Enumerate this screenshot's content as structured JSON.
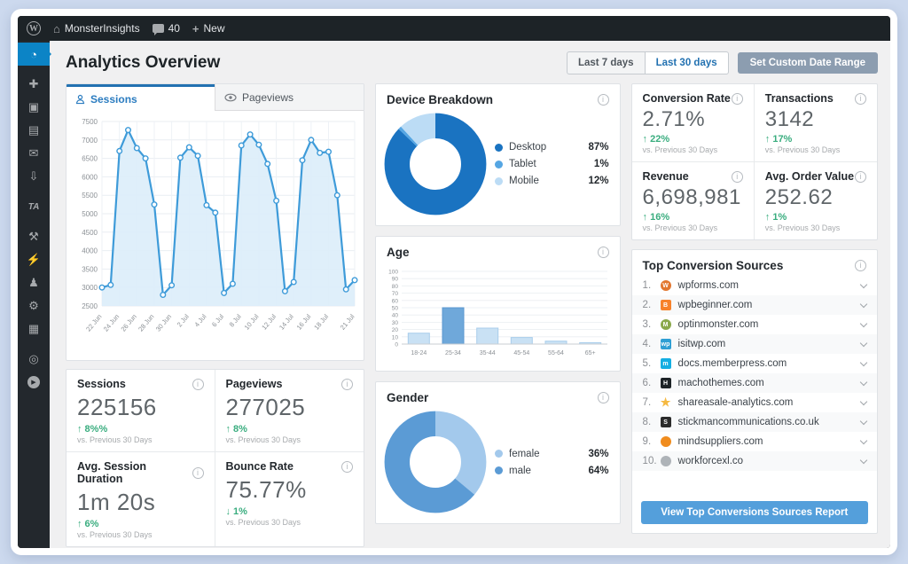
{
  "admin_bar": {
    "site": "MonsterInsights",
    "comments": "40",
    "new": "New"
  },
  "sidebar": {
    "items": [
      {
        "name": "dashboard",
        "glyph": "◔",
        "active": true
      },
      {
        "name": "pin",
        "glyph": "✚",
        "active": false
      },
      {
        "name": "media",
        "glyph": "▣",
        "active": false
      },
      {
        "name": "pages",
        "glyph": "▤",
        "active": false
      },
      {
        "name": "comments",
        "glyph": "✉",
        "active": false
      },
      {
        "name": "appearance",
        "glyph": "⇩",
        "active": false
      },
      {
        "name": "ta",
        "glyph": "TA",
        "active": false
      },
      {
        "name": "tools",
        "glyph": "⚒",
        "active": false
      },
      {
        "name": "plugins",
        "glyph": "⚡",
        "active": false
      },
      {
        "name": "users",
        "glyph": "♟",
        "active": false
      },
      {
        "name": "settings",
        "glyph": "⚙",
        "active": false
      },
      {
        "name": "modules",
        "glyph": "▦",
        "active": false
      },
      {
        "name": "analytics",
        "glyph": "◎",
        "active": false
      },
      {
        "name": "video",
        "glyph": "▶",
        "active": false
      }
    ]
  },
  "header": {
    "title": "Analytics Overview",
    "last7": "Last 7 days",
    "last30": "Last 30 days",
    "custom": "Set Custom Date Range"
  },
  "tabs": {
    "sessions": "Sessions",
    "pageviews": "Pageviews"
  },
  "colors": {
    "accent": "#2271b1",
    "green": "#3aad7f",
    "line": "#3e9bd9",
    "line_fill": "#dcedf9",
    "active_menu": "#0c84c6",
    "report_button": "#549fdb",
    "custom_range_button": "#8c9db0"
  },
  "chart_data": [
    {
      "id": "sessions_over_time",
      "type": "line",
      "title": "Sessions",
      "x": [
        "22 Jun",
        "23 Jun",
        "24 Jun",
        "25 Jun",
        "26 Jun",
        "27 Jun",
        "28 Jun",
        "29 Jun",
        "30 Jun",
        "1 Jul",
        "2 Jul",
        "3 Jul",
        "4 Jul",
        "5 Jul",
        "6 Jul",
        "7 Jul",
        "8 Jul",
        "9 Jul",
        "10 Jul",
        "11 Jul",
        "12 Jul",
        "13 Jul",
        "14 Jul",
        "15 Jul",
        "16 Jul",
        "17 Jul",
        "18 Jul",
        "19 Jul",
        "20 Jul",
        "21 Jul"
      ],
      "values": [
        3000,
        3070,
        6700,
        7270,
        6780,
        6500,
        5250,
        2800,
        3060,
        6520,
        6800,
        6570,
        5230,
        5030,
        2850,
        3100,
        6850,
        7150,
        6870,
        6350,
        5350,
        2900,
        3150,
        6450,
        7000,
        6650,
        6680,
        5500,
        2950,
        3200
      ],
      "ylim": [
        2500,
        7500
      ],
      "ytick_step": 500,
      "tick_indices": [
        0,
        2,
        4,
        6,
        8,
        10,
        12,
        14,
        16,
        18,
        20,
        22,
        24,
        26,
        29
      ],
      "grid": true,
      "legend_position": "none",
      "line_color": "#3e9bd9",
      "fill_color": "#dcedf9"
    },
    {
      "id": "device_breakdown",
      "type": "pie",
      "title": "Device Breakdown",
      "segments": [
        {
          "label": "Desktop",
          "value": 87,
          "display": "87%",
          "color": "#1a73c1"
        },
        {
          "label": "Tablet",
          "value": 1,
          "display": "1%",
          "color": "#55a6e3"
        },
        {
          "label": "Mobile",
          "value": 12,
          "display": "12%",
          "color": "#bcdcf5"
        }
      ],
      "legend_position": "right"
    },
    {
      "id": "age",
      "type": "bar",
      "title": "Age",
      "categories": [
        "18-24",
        "25-34",
        "35-44",
        "45-54",
        "55-64",
        "65+"
      ],
      "values": [
        15,
        50,
        22,
        9,
        4,
        2
      ],
      "ylim": [
        0,
        100
      ],
      "ytick_step": 10,
      "highlight_index": 1,
      "bar_color": "#c9e1f4",
      "bar_border": "#a9cdeb",
      "highlight_color": "#6fa8da",
      "highlight_border": "#5b97d0",
      "grid": true
    },
    {
      "id": "gender",
      "type": "pie",
      "title": "Gender",
      "segments": [
        {
          "label": "female",
          "value": 36,
          "display": "36%",
          "color": "#a3c9ec"
        },
        {
          "label": "male",
          "value": 64,
          "display": "64%",
          "color": "#5b9bd5"
        }
      ],
      "legend_position": "right"
    }
  ],
  "kpis_left": [
    {
      "label": "Sessions",
      "value": "225156",
      "trend": "8%%",
      "trend_dir": "up",
      "compare": "vs. Previous 30 Days"
    },
    {
      "label": "Pageviews",
      "value": "277025",
      "trend": "8%",
      "trend_dir": "up",
      "compare": "vs. Previous 30 Days"
    },
    {
      "label": "Avg. Session Duration",
      "value": "1m 20s",
      "trend": "6%",
      "trend_dir": "up",
      "compare": "vs. Previous 30 Days"
    },
    {
      "label": "Bounce Rate",
      "value": "75.77%",
      "trend": "1%",
      "trend_dir": "down",
      "compare": "vs. Previous 30 Days"
    }
  ],
  "kpis_right": [
    {
      "label": "Conversion Rate",
      "value": "2.71%",
      "trend": "22%",
      "trend_dir": "up",
      "compare": "vs. Previous 30 Days"
    },
    {
      "label": "Transactions",
      "value": "3142",
      "trend": "17%",
      "trend_dir": "up",
      "compare": "vs. Previous 30 Days"
    },
    {
      "label": "Revenue",
      "value": "6,698,981",
      "trend": "16%",
      "trend_dir": "up",
      "compare": "vs. Previous 30 Days"
    },
    {
      "label": "Avg. Order Value",
      "value": "252.62",
      "trend": "1%",
      "trend_dir": "up",
      "compare": "vs. Previous 30 Days"
    }
  ],
  "top_sources": {
    "title": "Top Conversion Sources",
    "button_label": "View Top Conversions Sources Report",
    "items": [
      {
        "rank": "1.",
        "domain": "wpforms.com",
        "favicon": {
          "shape": "circle",
          "color": "#e27730",
          "text": "W"
        }
      },
      {
        "rank": "2.",
        "domain": "wpbeginner.com",
        "favicon": {
          "shape": "square",
          "color": "#f7822a",
          "text": "B"
        }
      },
      {
        "rank": "3.",
        "domain": "optinmonster.com",
        "favicon": {
          "shape": "circle",
          "color": "#8aa84b",
          "text": "M"
        }
      },
      {
        "rank": "4.",
        "domain": "isitwp.com",
        "favicon": {
          "shape": "square",
          "color": "#2e9fd4",
          "text": "wp"
        }
      },
      {
        "rank": "5.",
        "domain": "docs.memberpress.com",
        "favicon": {
          "shape": "square",
          "color": "#14aee2",
          "text": "m"
        }
      },
      {
        "rank": "6.",
        "domain": "machothemes.com",
        "favicon": {
          "shape": "square",
          "color": "#1d2327",
          "text": "H"
        }
      },
      {
        "rank": "7.",
        "domain": "shareasale-analytics.com",
        "favicon": {
          "shape": "star",
          "color": "#f5b942",
          "text": "★"
        }
      },
      {
        "rank": "8.",
        "domain": "stickmancommunications.co.uk",
        "favicon": {
          "shape": "square",
          "color": "#2b2b2b",
          "text": "S"
        }
      },
      {
        "rank": "9.",
        "domain": "mindsuppliers.com",
        "favicon": {
          "shape": "circle",
          "color": "#f08c1e",
          "text": ""
        }
      },
      {
        "rank": "10.",
        "domain": "workforcexl.co",
        "favicon": {
          "shape": "circle",
          "color": "#aeb3b8",
          "text": ""
        }
      }
    ]
  }
}
